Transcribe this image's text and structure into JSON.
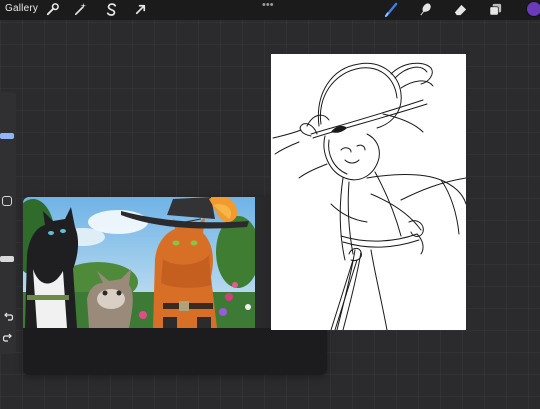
{
  "toolbar": {
    "gallery_label": "Gallery",
    "left_icons": [
      "wrench-icon",
      "magic-wand-icon",
      "selection-s-icon",
      "transform-arrow-icon"
    ],
    "more_icon": "more-dots-icon",
    "right_icons": [
      "brush-icon",
      "smudge-icon",
      "eraser-icon",
      "layers-icon"
    ],
    "active_tool": "brush-icon",
    "accent_color": "#3b82f6",
    "current_color": "#6a3ab8"
  },
  "sidebar": {
    "controls": [
      "brush-size-slider",
      "modify-button",
      "opacity-slider",
      "undo-icon",
      "redo-icon"
    ],
    "handle_color": "#d9d9d9",
    "active_handle_color": "#8fb6f5"
  },
  "reference": {
    "image_icon": "reference-photo",
    "background": "#1c1c1e"
  },
  "canvas": {
    "background": "#ffffff",
    "stroke_color": "#1a1a1a"
  }
}
